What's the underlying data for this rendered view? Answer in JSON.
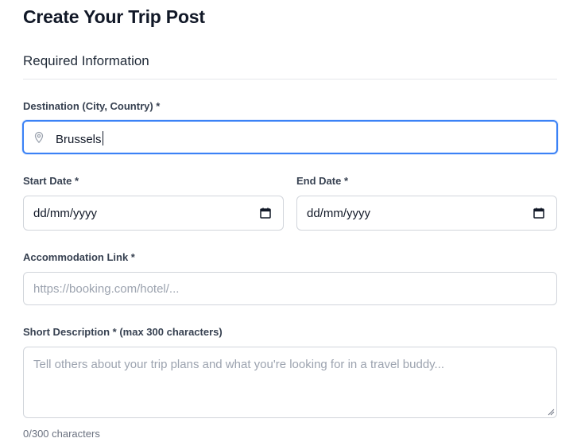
{
  "header": {
    "title": "Create Your Trip Post"
  },
  "section": {
    "title": "Required Information"
  },
  "destination": {
    "label": "Destination (City, Country) *",
    "value": "Brussels",
    "icon": "map-pin-icon"
  },
  "start_date": {
    "label": "Start Date *",
    "value": "dd/mm/yyyy",
    "icon": "calendar-icon"
  },
  "end_date": {
    "label": "End Date *",
    "value": "dd/mm/yyyy",
    "icon": "calendar-icon"
  },
  "accommodation": {
    "label": "Accommodation Link *",
    "placeholder": "https://booking.com/hotel/..."
  },
  "description": {
    "label": "Short Description * (max 300 characters)",
    "placeholder": "Tell others about your trip plans and what you're looking for in a travel buddy...",
    "counter": "0/300 characters"
  },
  "colors": {
    "focus_border": "#3b82f6",
    "border": "#d1d5db",
    "placeholder": "#9ca3af"
  }
}
